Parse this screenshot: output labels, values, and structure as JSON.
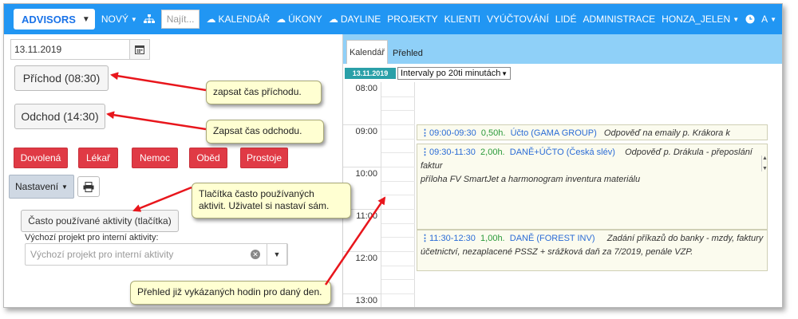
{
  "nav": {
    "brand": "ADVISORS",
    "novy": "NOVÝ",
    "search_placeholder": "Najít...",
    "items": [
      "KALENDÁŘ",
      "ÚKONY",
      "DAYLINE",
      "PROJEKTY",
      "KLIENTI",
      "VYÚČTOVÁNÍ",
      "LIDÉ",
      "ADMINISTRACE"
    ],
    "user": "HONZA_JELEN",
    "font_label": "A"
  },
  "left": {
    "date": "13.11.2019",
    "arrival_button": "Příchod (08:30)",
    "departure_button": "Odchod (14:30)",
    "absence_buttons": [
      "Dovolená",
      "Lékař",
      "Nemoc",
      "Oběd",
      "Prostoje"
    ],
    "settings_button": "Nastavení",
    "frequent_button": "Často používané aktivity (tlačítka)",
    "default_project_label": "Výchozí projekt pro interní aktivity:",
    "default_project_placeholder": "Výchozí projekt pro interní aktivity"
  },
  "callouts": {
    "arrival": "zapsat čas příchodu.",
    "departure": "Zapsat čas odchodu.",
    "frequent": "Tlačítka často používaných aktivit. Uživatel si nastaví sám.",
    "overview": "Přehled již vykázaných hodin pro daný den."
  },
  "calendar": {
    "tabs": [
      "Kalendář",
      "Přehled"
    ],
    "date_badge": "13.11.2019",
    "interval": "Intervaly po 20ti minutách",
    "hours": [
      "08:00",
      "09:00",
      "10:00",
      "11:00",
      "12:00",
      "13:00"
    ],
    "events": [
      {
        "time": "09:00-09:30",
        "hours": "0,50h.",
        "project": "Účto (GAMA GROUP)",
        "desc": "Odpověď na emaily p. Krákora k předauditu -"
      },
      {
        "time": "09:30-11:30",
        "hours": "2,00h.",
        "project": "DANĚ+ÚČTO (Česká slév)",
        "desc": "Odpověď p. Drákula - přeposlání faktur",
        "desc2": "příloha FV SmartJet a harmonogram inventura materiálu"
      },
      {
        "time": "11:30-12:30",
        "hours": "1,00h.",
        "project": "DANĚ (FOREST INV)",
        "desc": "Zadání příkazů do banky - mzdy, faktury",
        "desc2": "účetnictví, nezaplacené PSSZ + srážková daň za 7/2019, penále VZP."
      }
    ]
  },
  "colors": {
    "nav_bg": "#2196f3",
    "danger": "#e03a45",
    "callout_bg": "#ffffd2",
    "arrow": "#e8161c",
    "tabbar": "#8fd0f8"
  },
  "icons": [
    "caret-down-icon",
    "sitemap-icon",
    "calendar-icon",
    "print-icon",
    "clock-icon",
    "support-icon",
    "clear-icon"
  ]
}
